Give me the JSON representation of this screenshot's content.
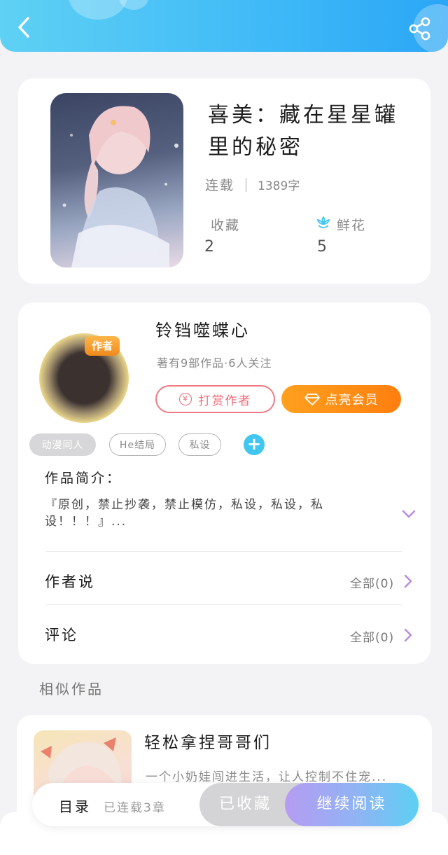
{
  "header": {
    "back_icon": "chevron-left-icon",
    "share_icon": "share-icon",
    "gradient_colors": [
      "#5fd1f4",
      "#2aa6f6"
    ]
  },
  "book": {
    "title": "喜美：藏在星星罐里的秘密",
    "status": "连载",
    "word_count": "1389字",
    "favorites_label": "收藏",
    "favorites_value": "2",
    "flowers_label": "鲜花",
    "flowers_value": "5",
    "flower_icon": "flower-icon"
  },
  "author": {
    "name": "铃铛噬蝶心",
    "badge": "作者",
    "stats": "著有9部作品·6人关注",
    "tip_button": "打赏作者",
    "tip_icon_char": "¥",
    "vip_button": "点亮会员",
    "vip_icon": "diamond-icon",
    "tags": [
      "动漫同人",
      "He结局",
      "私设"
    ],
    "add_tag": "+"
  },
  "intro": {
    "label": "作品简介：",
    "text": "『原创，禁止抄袭，禁止模仿，私设，私设，私设！！！』..."
  },
  "rows": {
    "author_says": {
      "label": "作者说",
      "right": "全部(0)"
    },
    "comments": {
      "label": "评论",
      "right": "全部(0)"
    }
  },
  "similar": {
    "section_title": "相似作品",
    "items": [
      {
        "title": "轻松拿捏哥哥们",
        "desc": "一个小奶娃闯进生活，让人控制不住宠..."
      }
    ]
  },
  "bottom": {
    "toc_label": "目录",
    "toc_sub": "已连载3章",
    "collected_button": "已收藏",
    "continue_button": "继续阅读"
  },
  "colors": {
    "accent_blue": "#40c6f1",
    "vip_orange": "#ff8a14",
    "tip_pink": "#ef6a76",
    "expand_purple": "#b58be0"
  }
}
